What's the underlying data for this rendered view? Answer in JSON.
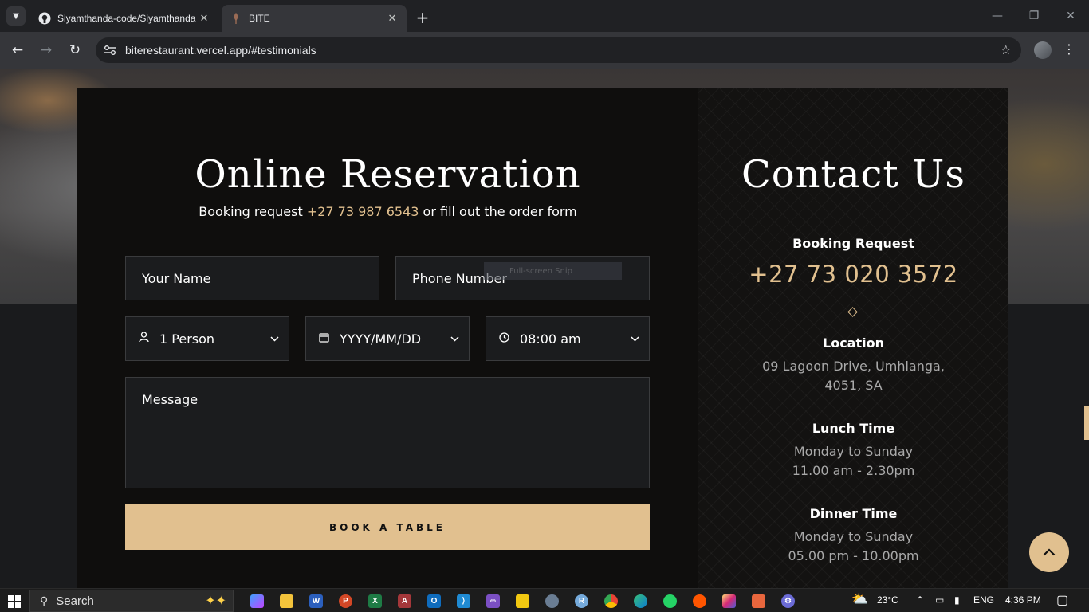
{
  "browser": {
    "tabs": [
      {
        "title": "Siyamthanda-code/Siyamthanda",
        "favicon": "github-icon",
        "active": false
      },
      {
        "title": "BITE",
        "favicon": "bite-icon",
        "active": true
      }
    ],
    "url": "biterestaurant.vercel.app/#testimonials"
  },
  "reservation": {
    "title": "Online Reservation",
    "subtitle_prefix": "Booking request",
    "subtitle_phone": "+27 73 987 6543",
    "subtitle_suffix": "or fill out the order form",
    "name_placeholder": "Your Name",
    "phone_placeholder": "Phone Number",
    "persons": "1 Person",
    "date": "YYYY/MM/DD",
    "time": "08:00 am",
    "message_placeholder": "Message",
    "button": "BOOK A TABLE",
    "snip_overlay": "Full-screen Snip"
  },
  "contact": {
    "title": "Contact Us",
    "booking_label": "Booking Request",
    "booking_phone": "+27 73 020 3572",
    "location_label": "Location",
    "location_line1": "09 Lagoon Drive, Umhlanga,",
    "location_line2": "4051, SA",
    "lunch_label": "Lunch Time",
    "lunch_days": "Monday to Sunday",
    "lunch_hours": "11.00 am - 2.30pm",
    "dinner_label": "Dinner Time",
    "dinner_days": "Monday to Sunday",
    "dinner_hours": "05.00 pm - 10.00pm"
  },
  "colors": {
    "accent": "#e1c08f",
    "panel": "#0f0e0d",
    "field": "#1b1c1e"
  },
  "taskbar": {
    "search": "Search",
    "weather": "23°C",
    "language": "ENG",
    "time": "4:36 PM"
  }
}
